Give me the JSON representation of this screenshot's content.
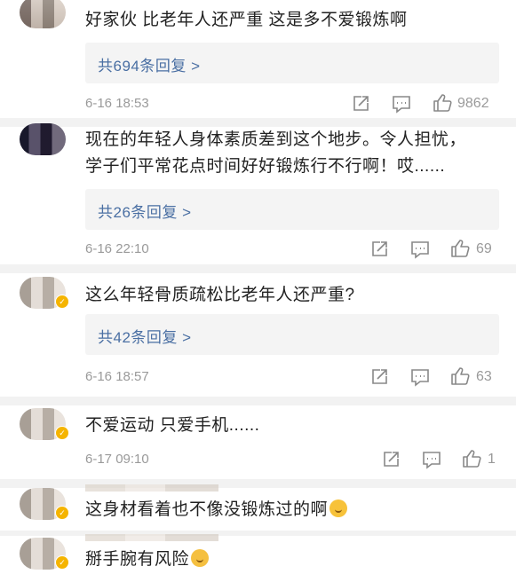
{
  "comments": [
    {
      "text": "好家伙 比老年人还严重 这是多不爱锻炼啊",
      "replies": "共694条回复 >",
      "time": "6-16 18:53",
      "likes": "9862"
    },
    {
      "text_line1": "现在的年轻人身体素质差到这个地步。令人担忧，",
      "text_line2": "学子们平常花点时间好好锻炼行不行啊！哎......",
      "replies": "共26条回复 >",
      "time": "6-16 22:10",
      "likes": "69"
    },
    {
      "text": "这么年轻骨质疏松比老年人还严重?",
      "replies": "共42条回复 >",
      "time": "6-16 18:57",
      "likes": "63"
    },
    {
      "text": "不爱运动 只爱手机......",
      "time": "6-17 09:10",
      "likes": "1"
    },
    {
      "text": "这身材看着也不像没锻炼过的啊",
      "emoji": "shush-face-emoji"
    },
    {
      "text": "掰手腕有风险",
      "emoji": "crying-laughing-emoji"
    }
  ],
  "colors": {
    "link": "#4a6fa3",
    "meta": "#9a9a9a",
    "badge": "#f5b400",
    "separator": "#f2f2f2"
  }
}
